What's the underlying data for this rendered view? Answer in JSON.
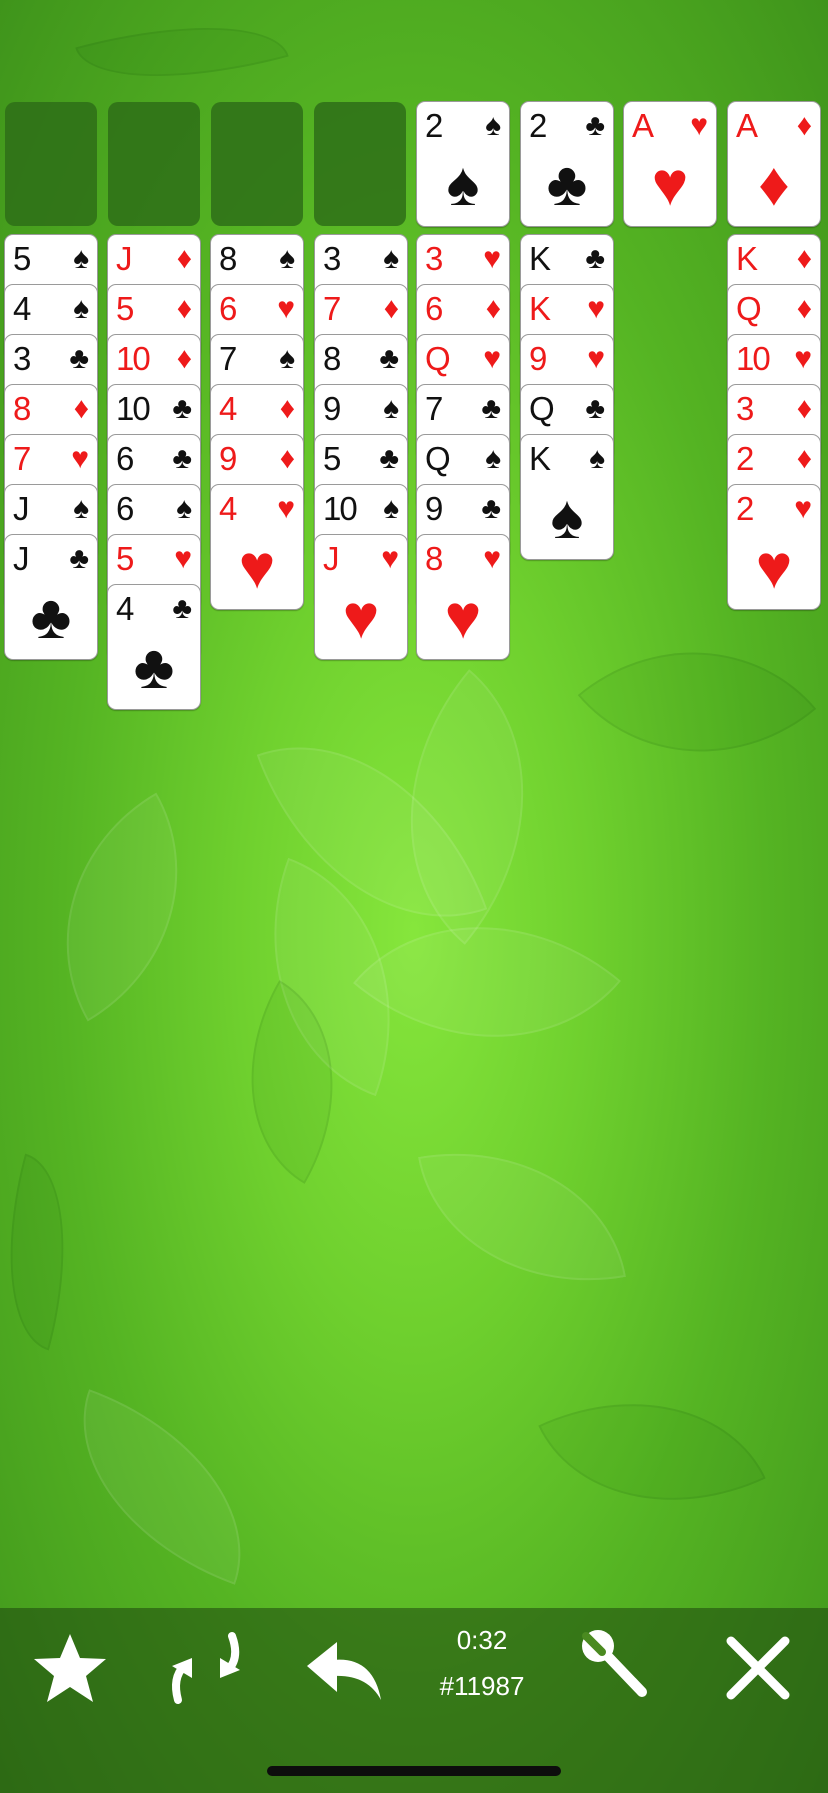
{
  "colors": {
    "red_suit": "#ee1a1a",
    "black_suit": "#111111",
    "felt_center": "#86e63c",
    "felt_edge": "#3f941b"
  },
  "free_cells": [
    "",
    "",
    "",
    ""
  ],
  "foundations": [
    {
      "rank": "2",
      "suit": "♠",
      "color": "black"
    },
    {
      "rank": "2",
      "suit": "♣",
      "color": "black"
    },
    {
      "rank": "A",
      "suit": "♥",
      "color": "red"
    },
    {
      "rank": "A",
      "suit": "♦",
      "color": "red"
    }
  ],
  "tableau": [
    [
      {
        "rank": "5",
        "suit": "♠",
        "color": "black"
      },
      {
        "rank": "4",
        "suit": "♠",
        "color": "black"
      },
      {
        "rank": "3",
        "suit": "♣",
        "color": "black"
      },
      {
        "rank": "8",
        "suit": "♦",
        "color": "red"
      },
      {
        "rank": "7",
        "suit": "♥",
        "color": "red"
      },
      {
        "rank": "J",
        "suit": "♠",
        "color": "black"
      },
      {
        "rank": "J",
        "suit": "♣",
        "color": "black"
      }
    ],
    [
      {
        "rank": "J",
        "suit": "♦",
        "color": "red"
      },
      {
        "rank": "5",
        "suit": "♦",
        "color": "red"
      },
      {
        "rank": "10",
        "suit": "♦",
        "color": "red"
      },
      {
        "rank": "10",
        "suit": "♣",
        "color": "black"
      },
      {
        "rank": "6",
        "suit": "♣",
        "color": "black"
      },
      {
        "rank": "6",
        "suit": "♠",
        "color": "black"
      },
      {
        "rank": "5",
        "suit": "♥",
        "color": "red"
      },
      {
        "rank": "4",
        "suit": "♣",
        "color": "black"
      }
    ],
    [
      {
        "rank": "8",
        "suit": "♠",
        "color": "black"
      },
      {
        "rank": "6",
        "suit": "♥",
        "color": "red"
      },
      {
        "rank": "7",
        "suit": "♠",
        "color": "black"
      },
      {
        "rank": "4",
        "suit": "♦",
        "color": "red"
      },
      {
        "rank": "9",
        "suit": "♦",
        "color": "red"
      },
      {
        "rank": "4",
        "suit": "♥",
        "color": "red"
      }
    ],
    [
      {
        "rank": "3",
        "suit": "♠",
        "color": "black"
      },
      {
        "rank": "7",
        "suit": "♦",
        "color": "red"
      },
      {
        "rank": "8",
        "suit": "♣",
        "color": "black"
      },
      {
        "rank": "9",
        "suit": "♠",
        "color": "black"
      },
      {
        "rank": "5",
        "suit": "♣",
        "color": "black"
      },
      {
        "rank": "10",
        "suit": "♠",
        "color": "black"
      },
      {
        "rank": "J",
        "suit": "♥",
        "color": "red"
      }
    ],
    [
      {
        "rank": "3",
        "suit": "♥",
        "color": "red"
      },
      {
        "rank": "6",
        "suit": "♦",
        "color": "red"
      },
      {
        "rank": "Q",
        "suit": "♥",
        "color": "red"
      },
      {
        "rank": "7",
        "suit": "♣",
        "color": "black"
      },
      {
        "rank": "Q",
        "suit": "♠",
        "color": "black"
      },
      {
        "rank": "9",
        "suit": "♣",
        "color": "black"
      },
      {
        "rank": "8",
        "suit": "♥",
        "color": "red"
      }
    ],
    [
      {
        "rank": "K",
        "suit": "♣",
        "color": "black"
      },
      {
        "rank": "K",
        "suit": "♥",
        "color": "red"
      },
      {
        "rank": "9",
        "suit": "♥",
        "color": "red"
      },
      {
        "rank": "Q",
        "suit": "♣",
        "color": "black"
      },
      {
        "rank": "K",
        "suit": "♠",
        "color": "black"
      }
    ],
    [],
    [
      {
        "rank": "K",
        "suit": "♦",
        "color": "red"
      },
      {
        "rank": "Q",
        "suit": "♦",
        "color": "red"
      },
      {
        "rank": "10",
        "suit": "♥",
        "color": "red"
      },
      {
        "rank": "3",
        "suit": "♦",
        "color": "red"
      },
      {
        "rank": "2",
        "suit": "♦",
        "color": "red"
      },
      {
        "rank": "2",
        "suit": "♥",
        "color": "red"
      }
    ]
  ],
  "toolbar": {
    "buttons": [
      {
        "name": "favorite-button",
        "icon": "star-icon"
      },
      {
        "name": "new-game-button",
        "icon": "shuffle-icon"
      },
      {
        "name": "undo-button",
        "icon": "undo-icon"
      },
      {
        "name": "settings-button",
        "icon": "wrench-icon"
      },
      {
        "name": "close-button",
        "icon": "close-icon"
      }
    ],
    "timer": "0:32",
    "game_number": "#11987"
  }
}
